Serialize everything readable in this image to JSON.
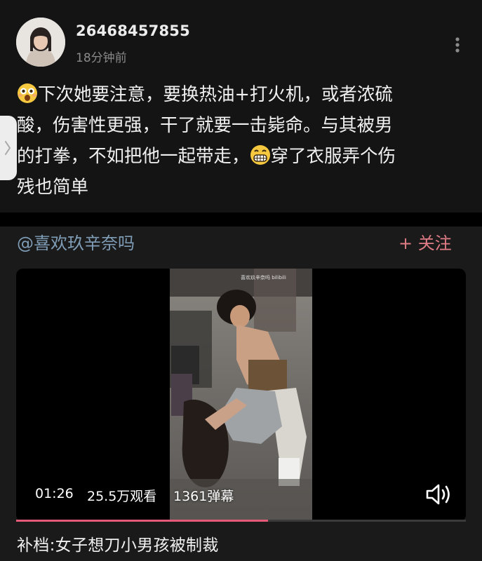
{
  "post": {
    "username": "26468457855",
    "time": "18分钟前",
    "lines": [
      "下次她要注意，要换热油+打火机，或者浓硫",
      "酸，伤害性更强，干了就要一击毙命。与其被男",
      "的打拳，不如把他一起带走，",
      "穿了衣服弄个伤",
      "残也简单"
    ],
    "emoji_1": "shocked-face-icon",
    "emoji_2": "grinning-face-icon"
  },
  "forward": {
    "mention": "@喜欢玖辛奈吗",
    "follow_label": "+ 关注"
  },
  "video": {
    "duration": "01:26",
    "views": "25.5万观看",
    "danmaku": "1361弹幕",
    "watermark": "喜欢玖辛奈吗 bilibili",
    "progress": 0.56,
    "title": "补档:女子想刀小男孩被制裁"
  },
  "colors": {
    "card_bg": "#141414",
    "mention": "#7f9db6",
    "follow": "#e07c85",
    "progress": "#e55a78"
  }
}
